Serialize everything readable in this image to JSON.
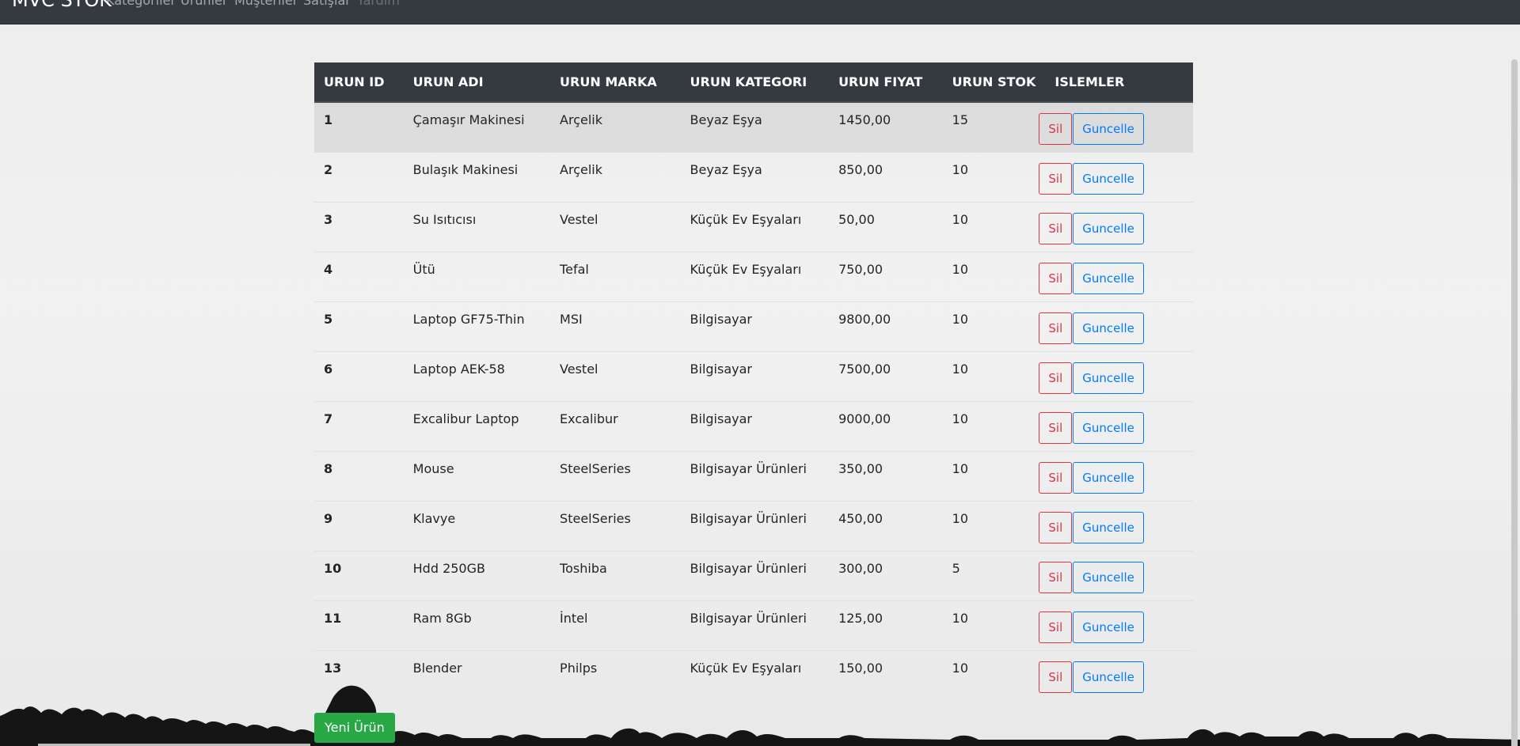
{
  "navbar": {
    "brand": "MVC STOK",
    "links": [
      "Kategoriler",
      "Ürünler",
      "Müşteriler",
      "Satışlar",
      "Yardım"
    ]
  },
  "table": {
    "headers": [
      "URUN ID",
      "URUN ADI",
      "URUN MARKA",
      "URUN KATEGORI",
      "URUN FIYAT",
      "URUN STOK",
      "ISLEMLER"
    ],
    "rows": [
      {
        "id": "1",
        "name": "Çamaşır Makinesi",
        "brand": "Arçelik",
        "category": "Beyaz Eşya",
        "price": "1450,00",
        "stock": "15"
      },
      {
        "id": "2",
        "name": "Bulaşık Makinesi",
        "brand": "Arçelik",
        "category": "Beyaz Eşya",
        "price": "850,00",
        "stock": "10"
      },
      {
        "id": "3",
        "name": "Su Isıtıcısı",
        "brand": "Vestel",
        "category": "Küçük Ev Eşyaları",
        "price": "50,00",
        "stock": "10"
      },
      {
        "id": "4",
        "name": "Ütü",
        "brand": "Tefal",
        "category": "Küçük Ev Eşyaları",
        "price": "750,00",
        "stock": "10"
      },
      {
        "id": "5",
        "name": "Laptop GF75-Thin",
        "brand": "MSI",
        "category": "Bilgisayar",
        "price": "9800,00",
        "stock": "10"
      },
      {
        "id": "6",
        "name": "Laptop AEK-58",
        "brand": "Vestel",
        "category": "Bilgisayar",
        "price": "7500,00",
        "stock": "10"
      },
      {
        "id": "7",
        "name": "Excalibur Laptop",
        "brand": "Excalibur",
        "category": "Bilgisayar",
        "price": "9000,00",
        "stock": "10"
      },
      {
        "id": "8",
        "name": "Mouse",
        "brand": "SteelSeries",
        "category": "Bilgisayar Ürünleri",
        "price": "350,00",
        "stock": "10"
      },
      {
        "id": "9",
        "name": "Klavye",
        "brand": "SteelSeries",
        "category": "Bilgisayar Ürünleri",
        "price": "450,00",
        "stock": "10"
      },
      {
        "id": "10",
        "name": "Hdd 250GB",
        "brand": "Toshiba",
        "category": "Bilgisayar Ürünleri",
        "price": "300,00",
        "stock": "5"
      },
      {
        "id": "11",
        "name": "Ram 8Gb",
        "brand": "İntel",
        "category": "Bilgisayar Ürünleri",
        "price": "125,00",
        "stock": "10"
      },
      {
        "id": "13",
        "name": "Blender",
        "brand": "Philps",
        "category": "Küçük Ev Eşyaları",
        "price": "150,00",
        "stock": "10"
      }
    ]
  },
  "actions": {
    "delete_label": "Sil",
    "update_label": "Guncelle",
    "new_product_label": "Yeni Ürün"
  },
  "colors": {
    "navbar": "#343a40",
    "danger": "#dc3545",
    "primary": "#007bff",
    "success": "#28a745"
  }
}
